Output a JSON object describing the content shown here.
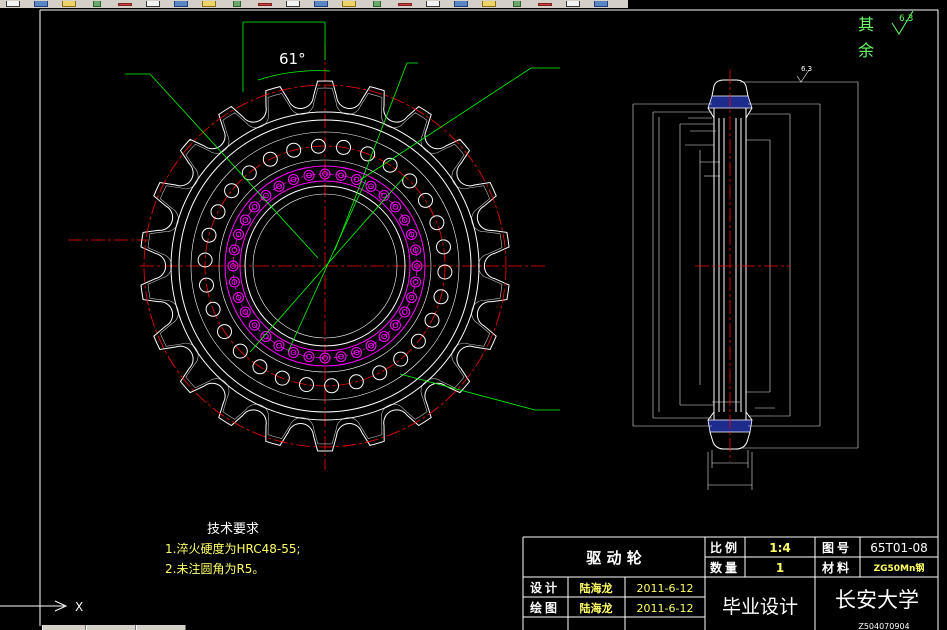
{
  "toolbar": {
    "icons": [
      "new-icon",
      "open-icon",
      "save-icon",
      "print-icon",
      "print-preview-icon",
      "publish-icon",
      "cut-icon",
      "copy-icon",
      "paste-icon",
      "match-properties-icon",
      "undo-icon",
      "redo-icon",
      "pan-icon",
      "zoom-realtime-icon",
      "zoom-window-icon",
      "zoom-previous-icon",
      "properties-icon",
      "design-center-icon",
      "tool-palettes-icon",
      "sheet-set-icon",
      "markup-icon",
      "calculator-icon"
    ]
  },
  "colors": {
    "canvas": "#000000",
    "outline": "#ffffff",
    "centerline": "#ff0000",
    "holes": "#ff00ff",
    "leader": "#00ff00",
    "section_fill": "#1c2b8c",
    "value_text": "#ffff66",
    "note_text": "#66ff66",
    "ui_chrome": "#d4d0c8"
  },
  "drawing": {
    "angle_label": "61°",
    "roughness_other_1": "其",
    "roughness_other_2": "余",
    "roughness_other_value": "6.3",
    "side_roughness_value": "6.3"
  },
  "requirements": {
    "title": "技术要求",
    "item_1": "1.淬火硬度为HRC48-55;",
    "item_2": "2.未注圆角为R5。"
  },
  "title_block": {
    "part_name": "驱 动 轮",
    "scale_label": "比例",
    "scale_value": "1:4",
    "drawing_no_label": "图号",
    "drawing_no": "65T01-08",
    "quantity_label": "数量",
    "quantity_value": "1",
    "material_label": "材料",
    "material_value": "ZG50Mn钢",
    "designer_label": "设计",
    "designer_name": "陆海龙",
    "design_date": "2011-6-12",
    "drafter_label": "绘图",
    "drafter_name": "陆海龙",
    "draft_date": "2011-6-12",
    "project": "毕业设计",
    "school": "长安大学",
    "student_no": "Z504070904"
  },
  "ucs": {
    "x_axis_label": "X"
  }
}
